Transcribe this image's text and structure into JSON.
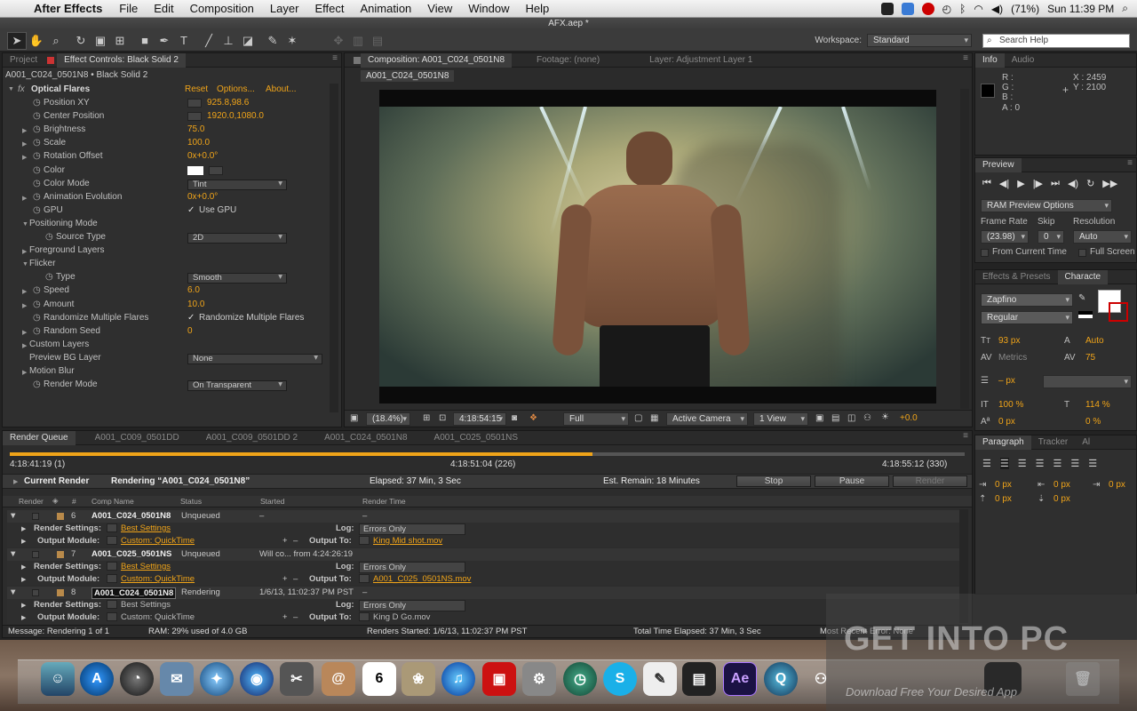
{
  "menubar": {
    "app": "After Effects",
    "items": [
      "File",
      "Edit",
      "Composition",
      "Layer",
      "Effect",
      "Animation",
      "View",
      "Window",
      "Help"
    ],
    "battery": "(71%)",
    "clock": "Sun 11:39 PM"
  },
  "window": {
    "title": "AFX.aep *"
  },
  "toolbar": {
    "workspace_label": "Workspace:",
    "workspace_value": "Standard",
    "search_placeholder": "Search Help"
  },
  "left_panel": {
    "tab_project": "Project",
    "tab_effect": "Effect Controls: Black Solid 2",
    "layer_path": "A001_C024_0501N8 • Black Solid 2",
    "effect_name": "Optical Flares",
    "reset": "Reset",
    "options": "Options...",
    "about": "About...",
    "rows": [
      {
        "label": "Position XY",
        "value": "925.8,98.6"
      },
      {
        "label": "Center Position",
        "value": "1920.0,1080.0"
      },
      {
        "label": "Brightness",
        "value": "75.0"
      },
      {
        "label": "Scale",
        "value": "100.0"
      },
      {
        "label": "Rotation Offset",
        "value": "0x+0.0°"
      },
      {
        "label": "Color",
        "value": ""
      },
      {
        "label": "Color Mode",
        "value": "Tint"
      },
      {
        "label": "Animation Evolution",
        "value": "0x+0.0°"
      },
      {
        "label": "GPU",
        "value": "Use GPU"
      },
      {
        "label": "Positioning Mode",
        "value": ""
      },
      {
        "label": "Source Type",
        "value": "2D"
      },
      {
        "label": "Foreground Layers",
        "value": ""
      },
      {
        "label": "Flicker",
        "value": ""
      },
      {
        "label": "Type",
        "value": "Smooth"
      },
      {
        "label": "Speed",
        "value": "6.0"
      },
      {
        "label": "Amount",
        "value": "10.0"
      },
      {
        "label": "Randomize Multiple Flares",
        "value": "Randomize Multiple Flares"
      },
      {
        "label": "Random Seed",
        "value": "0"
      },
      {
        "label": "Custom Layers",
        "value": ""
      },
      {
        "label": "Preview BG Layer",
        "value": "None"
      },
      {
        "label": "Motion Blur",
        "value": ""
      },
      {
        "label": "Render Mode",
        "value": "On Transparent"
      }
    ]
  },
  "comp_panel": {
    "tab_comp": "Composition: A001_C024_0501N8",
    "tab_footage": "Footage: (none)",
    "tab_layer": "Layer: Adjustment Layer 1",
    "comp_chip": "A001_C024_0501N8",
    "zoom": "(18.4%)",
    "timecode": "4:18:54:15",
    "resolution": "Full",
    "camera": "Active Camera",
    "views": "1 View",
    "exposure": "+0.0"
  },
  "info_panel": {
    "tab_info": "Info",
    "tab_audio": "Audio",
    "r": "R :",
    "g": "G :",
    "b": "B :",
    "a": "A : 0",
    "x": "X : 2459",
    "y": "Y : 2100"
  },
  "preview_panel": {
    "tab": "Preview",
    "ram_options": "RAM Preview Options",
    "frame_rate_label": "Frame Rate",
    "skip_label": "Skip",
    "resolution_label": "Resolution",
    "frame_rate": "(23.98)",
    "skip": "0",
    "resolution": "Auto",
    "from_current": "From Current Time",
    "full_screen": "Full Screen"
  },
  "char_panel": {
    "tab_effects": "Effects & Presets",
    "tab_char": "Characte",
    "font": "Zapfino",
    "style": "Regular",
    "size": "93 px",
    "leading": "Auto",
    "kerning": "Metrics",
    "tracking": "75",
    "stroke": "– px",
    "vscale": "100 %",
    "hscale": "114 %",
    "baseline": "0 px",
    "tsume": "0 %"
  },
  "para_panel": {
    "tab_para": "Paragraph",
    "tab_tracker": "Tracker",
    "tab_al": "Al",
    "i1": "0 px",
    "i2": "0 px",
    "i3": "0 px",
    "i4": "0 px",
    "i5": "0 px"
  },
  "render_queue": {
    "tabs": [
      "Render Queue",
      "A001_C009_0501DD",
      "A001_C009_0501DD 2",
      "A001_C024_0501N8",
      "A001_C025_0501NS"
    ],
    "time_start": "4:18:41:19 (1)",
    "time_mid": "4:18:51:04 (226)",
    "time_end": "4:18:55:12 (330)",
    "progress": 0.61,
    "current_render": "Current Render",
    "rendering": "Rendering “A001_C024_0501N8”",
    "elapsed": "Elapsed: 37 Min, 3 Sec",
    "remain": "Est. Remain: 18 Minutes",
    "stop": "Stop",
    "pause": "Pause",
    "render_btn": "Render",
    "cols": [
      "Render",
      "#",
      "Comp Name",
      "Status",
      "Started",
      "Render Time"
    ],
    "items": [
      {
        "num": "6",
        "name": "A001_C024_0501N8",
        "status": "Unqueued",
        "started": "–",
        "rtime": "–",
        "settings": "Best Settings",
        "log": "Errors Only",
        "module": "Custom: QuickTime",
        "output": "King Mid shot.mov"
      },
      {
        "num": "7",
        "name": "A001_C025_0501NS",
        "status": "Unqueued",
        "started": "Will co... from 4:24:26:19",
        "rtime": "",
        "settings": "Best Settings",
        "log": "Errors Only",
        "module": "Custom: QuickTime",
        "output": "A001_C025_0501NS.mov"
      },
      {
        "num": "8",
        "name": "A001_C024_0501N8",
        "status": "Rendering",
        "started": "1/6/13, 11:02:37 PM PST",
        "rtime": "–",
        "settings": "Best Settings",
        "log": "Errors Only",
        "module": "Custom: QuickTime",
        "output": "King D Go.mov"
      }
    ],
    "lbl_settings": "Render Settings:",
    "lbl_module": "Output Module:",
    "lbl_log": "Log:",
    "lbl_output": "Output To:",
    "status": {
      "message": "Message: Rendering 1 of 1",
      "ram": "RAM: 29% used of 4.0 GB",
      "started": "Renders Started: 1/6/13, 11:02:37 PM PST",
      "total": "Total Time Elapsed: 37 Min, 3 Sec",
      "error": "Most Recent Error: None"
    }
  },
  "watermark": {
    "title": "GET INTO PC",
    "sub": "Download Free Your Desired App"
  },
  "colors": {
    "accent": "#f0a419",
    "panel": "#2f2f2f"
  }
}
